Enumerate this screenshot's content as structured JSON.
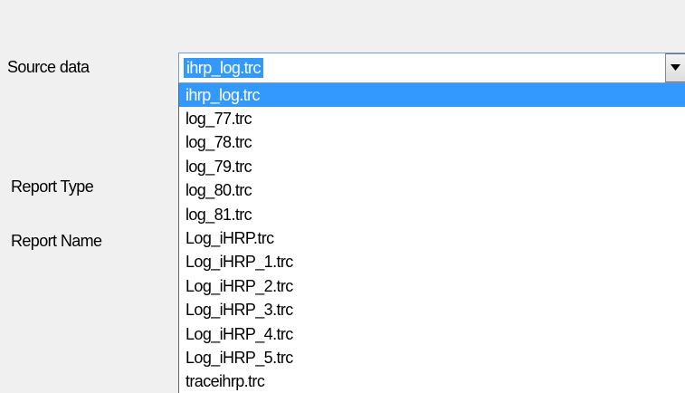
{
  "form": {
    "source_label": "Source data",
    "report_type_label": "Report Type",
    "report_name_label": "Report Name"
  },
  "source_combo": {
    "value": "ihrp_log.trc",
    "options": [
      "ihrp_log.trc",
      "log_77.trc",
      "log_78.trc",
      "log_79.trc",
      "log_80.trc",
      "log_81.trc",
      "Log_iHRP.trc",
      "Log_iHRP_1.trc",
      "Log_iHRP_2.trc",
      "Log_iHRP_3.trc",
      "Log_iHRP_4.trc",
      "Log_iHRP_5.trc",
      "traceihrp.trc"
    ],
    "selected_index": 0
  },
  "colors": {
    "selection": "#3399ff",
    "window_bg": "#f0f0f0"
  }
}
